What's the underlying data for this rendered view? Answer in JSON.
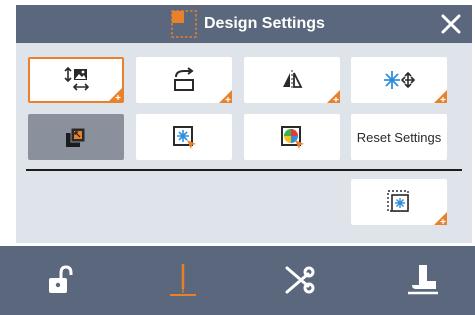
{
  "dialog": {
    "title": "Design Settings",
    "title_icon": "resize-selection-icon",
    "close_icon": "close-icon"
  },
  "tiles": [
    {
      "icon": "resize-image-icon",
      "selected": true
    },
    {
      "icon": "rotate-icon"
    },
    {
      "icon": "mirror-icon"
    },
    {
      "icon": "move-pattern-icon"
    },
    {
      "icon": "layer-order-icon",
      "disabled": true
    },
    {
      "icon": "pattern-select-icon"
    },
    {
      "icon": "color-palette-icon"
    },
    {
      "label": "Reset Settings"
    },
    {
      "icon": "pattern-frame-icon"
    }
  ],
  "bottom_bar": [
    {
      "icon": "unlock-icon"
    },
    {
      "icon": "needle-icon"
    },
    {
      "icon": "scissors-icon"
    },
    {
      "icon": "presser-foot-icon"
    }
  ],
  "colors": {
    "accent": "#e8812a",
    "bar": "#5b677c",
    "panel": "#dfe3ea",
    "blue": "#2f8fdd"
  }
}
